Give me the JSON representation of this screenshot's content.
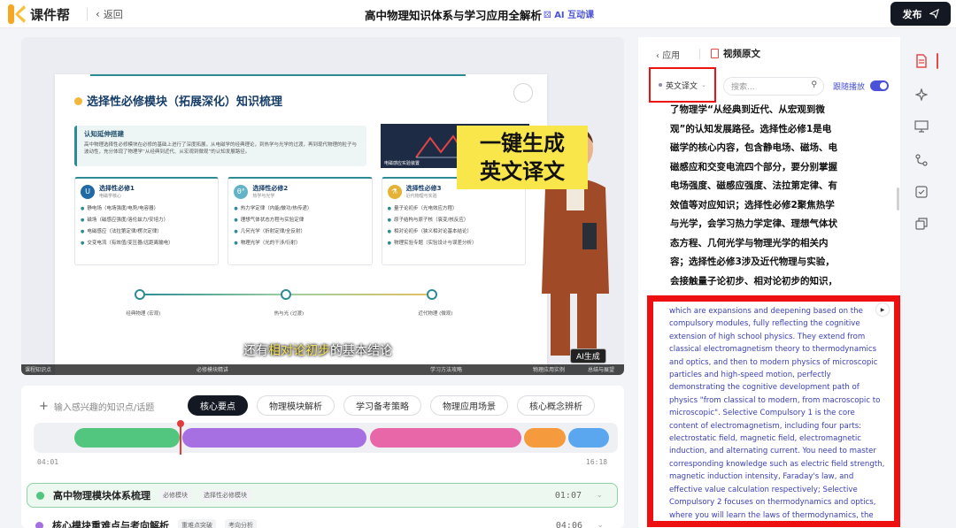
{
  "header": {
    "brand": "课件帮",
    "back_label": "返回",
    "title": "高中物理知识体系与学习应用全解析",
    "ai_tag": "AI 互动课",
    "publish_label": "发布"
  },
  "slide": {
    "title": "选择性必修模块（拓展深化）知识梳理",
    "intro_title": "认知延伸搭建",
    "intro_text": "高中物理选择性必修模块在必修的基础上进行了深度拓展，从电磁学的经典理论，到热学与光学的过渡，再到现代物理的粒子与波动性，充分体现了物理学“从经典到近代、从宏观到微观”的认知发展路径。",
    "image_caption": "电磁感应实验装置",
    "cards": [
      {
        "icon": "U",
        "color": "#1f6aa5",
        "title": "选择性必修1",
        "sub": "电磁学核心",
        "items": [
          "静电场（电场强度/电势/电容器）",
          "磁场（磁感应强度/洛伦兹力/安培力）",
          "电磁感应（法拉第定律/楞次定律）",
          "交变电流（有效值/变压器/远距离输电）"
        ]
      },
      {
        "icon": "θ°",
        "color": "#63b3c7",
        "title": "选择性必修2",
        "sub": "热学与光学",
        "items": [
          "热力学定律（内能/做功/热传递）",
          "理想气体状态方程与实验定律",
          "几何光学（折射定律/全反射）",
          "物理光学（光的干涉/衍射）"
        ]
      },
      {
        "icon": "⚗",
        "color": "#e5b235",
        "title": "选择性必修3",
        "sub": "近代物理与实验",
        "items": [
          "量子论初步（光电效应方程）",
          "原子结构与原子核（衰变/核反应）",
          "相对论初步（狭义相对论基本结论）",
          "物理实验专题（实验设计与误差分析）"
        ]
      }
    ],
    "timeline": [
      "经典物理 (宏观)",
      "热与光 (过渡)",
      "近代物理 (微观)"
    ],
    "callout_line1": "一键生成",
    "callout_line2": "英文译文",
    "subtitle_before": "还有",
    "subtitle_highlight": "相对论初步",
    "subtitle_after": "的基本结论",
    "ai_badge": "AI生成",
    "bar_labels": [
      "课程知识点",
      "必修模块精讲",
      "学习方法攻略",
      "物理应用实例",
      "总结与展望"
    ]
  },
  "knowledge": {
    "input_placeholder": "输入感兴趣的知识点/话题",
    "chips": [
      "核心要点",
      "物理模块解析",
      "学习备考策略",
      "物理应用场景",
      "核心概念辨析"
    ],
    "active_chip": 0,
    "segments": [
      {
        "color": "#52c57f",
        "start": 0.07,
        "end": 0.25
      },
      {
        "color": "#a670e3",
        "start": 0.255,
        "end": 0.57
      },
      {
        "color": "#e767a8",
        "start": 0.575,
        "end": 0.835
      },
      {
        "color": "#f59b3d",
        "start": 0.84,
        "end": 0.91
      },
      {
        "color": "#5aa7f0",
        "start": 0.915,
        "end": 0.985
      }
    ],
    "playhead": 0.25,
    "time_start": "04:01",
    "time_end": "16:18",
    "rows": [
      {
        "title": "高中物理模块体系梳理",
        "tags": [
          "必修模块",
          "选择性必修模块"
        ],
        "time": "01:07",
        "color": "#52c57f",
        "active": true
      },
      {
        "title": "核心模块重难点与考向解析",
        "tags": [
          "重难点突破",
          "考向分析"
        ],
        "time": "04:06",
        "color": "#a670e3",
        "active": false
      }
    ]
  },
  "transcript": {
    "back_label": "应用",
    "title": "视频原文",
    "lang_label": "英文译文",
    "search_placeholder": "搜索...",
    "follow_label": "跟随播放",
    "cn_text": "了物理学“从经典到近代、从宏观到微观”的认知发展路径。选择性必修1是电磁学的核心内容，包含静电场、磁场、电磁感应和交变电流四个部分，要分别掌握电场强度、磁感应强度、法拉第定律、有效值等对应知识；选择性必修2聚焦热学与光学，会学习热力学定律、理想气体状态方程、几何光学与物理光学的相关内容；选择性必修3涉及近代物理与实验，会接触量子论初步、相对论初步的知识，还要学习物理实验的设计和误差分析。",
    "en_text": "which are expansions and deepening based on the compulsory modules, fully reflecting the cognitive extension of high school physics. They extend from classical electromagnetism theory to thermodynamics and optics, and then to modern physics of microscopic particles and high-speed motion, perfectly demonstrating the cognitive development path of physics \"from classical to modern, from macroscopic to microscopic\". Selective Compulsory 1 is the core content of electromagnetism, including four parts: electrostatic field, magnetic field, electromagnetic induction, and alternating current. You need to master corresponding knowledge such as electric field strength, magnetic induction intensity, Faraday's law, and effective value calculation respectively; Selective Compulsory 2 focuses on thermodynamics and optics, where you will learn the laws of thermodynamics, the"
  },
  "colors": {
    "accent": "#4a52d8",
    "highlight_red": "#ee1010",
    "callout_yellow": "#f9e64a"
  },
  "rail_icons": [
    "document-icon",
    "sparkle-icon",
    "presentation-icon",
    "flow-icon",
    "checklist-icon",
    "layers-icon"
  ]
}
